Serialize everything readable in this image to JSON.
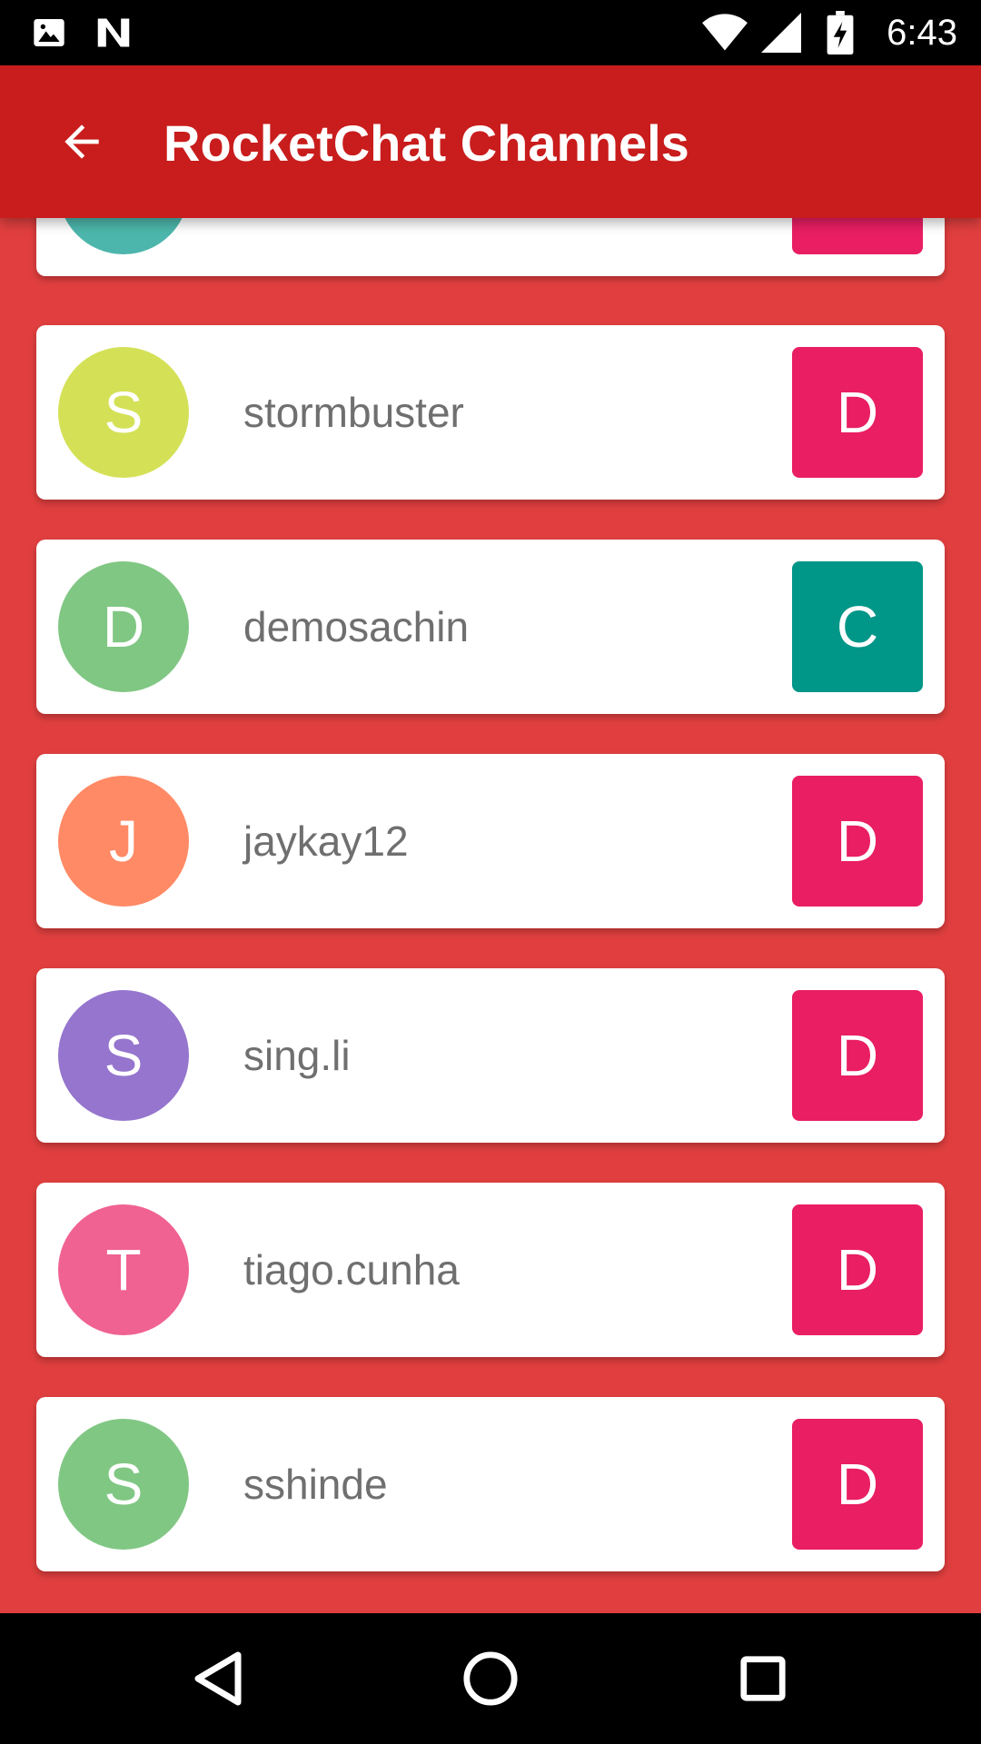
{
  "status_bar": {
    "time": "6:43",
    "icons": [
      "image-notification-icon",
      "n-notification-icon",
      "wifi-icon",
      "cellular-signal-icon",
      "battery-charging-icon"
    ]
  },
  "toolbar": {
    "title": "RocketChat Channels",
    "back_icon": "arrow-back-icon"
  },
  "channels": [
    {
      "name": "",
      "initial": "",
      "avatar_color": "#4DB6AC",
      "type": "",
      "type_color": "#E91E63",
      "partial": true
    },
    {
      "name": "stormbuster",
      "initial": "S",
      "avatar_color": "#D4E157",
      "type": "D",
      "type_color": "#E91E63"
    },
    {
      "name": "demosachin",
      "initial": "D",
      "avatar_color": "#81C784",
      "type": "C",
      "type_color": "#009688"
    },
    {
      "name": "jaykay12",
      "initial": "J",
      "avatar_color": "#FF8A65",
      "type": "D",
      "type_color": "#E91E63"
    },
    {
      "name": "sing.li",
      "initial": "S",
      "avatar_color": "#9575CD",
      "type": "D",
      "type_color": "#E91E63"
    },
    {
      "name": "tiago.cunha",
      "initial": "T",
      "avatar_color": "#F06292",
      "type": "D",
      "type_color": "#E91E63"
    },
    {
      "name": "sshinde",
      "initial": "S",
      "avatar_color": "#81C784",
      "type": "D",
      "type_color": "#E91E63"
    }
  ],
  "colors": {
    "toolbar": "#C91C1C",
    "background": "#E13F3F",
    "card": "#FFFFFF",
    "name_text": "#6F6F6F"
  },
  "nav_bar": {
    "icons": [
      "back-nav-icon",
      "home-nav-icon",
      "recents-nav-icon"
    ]
  }
}
